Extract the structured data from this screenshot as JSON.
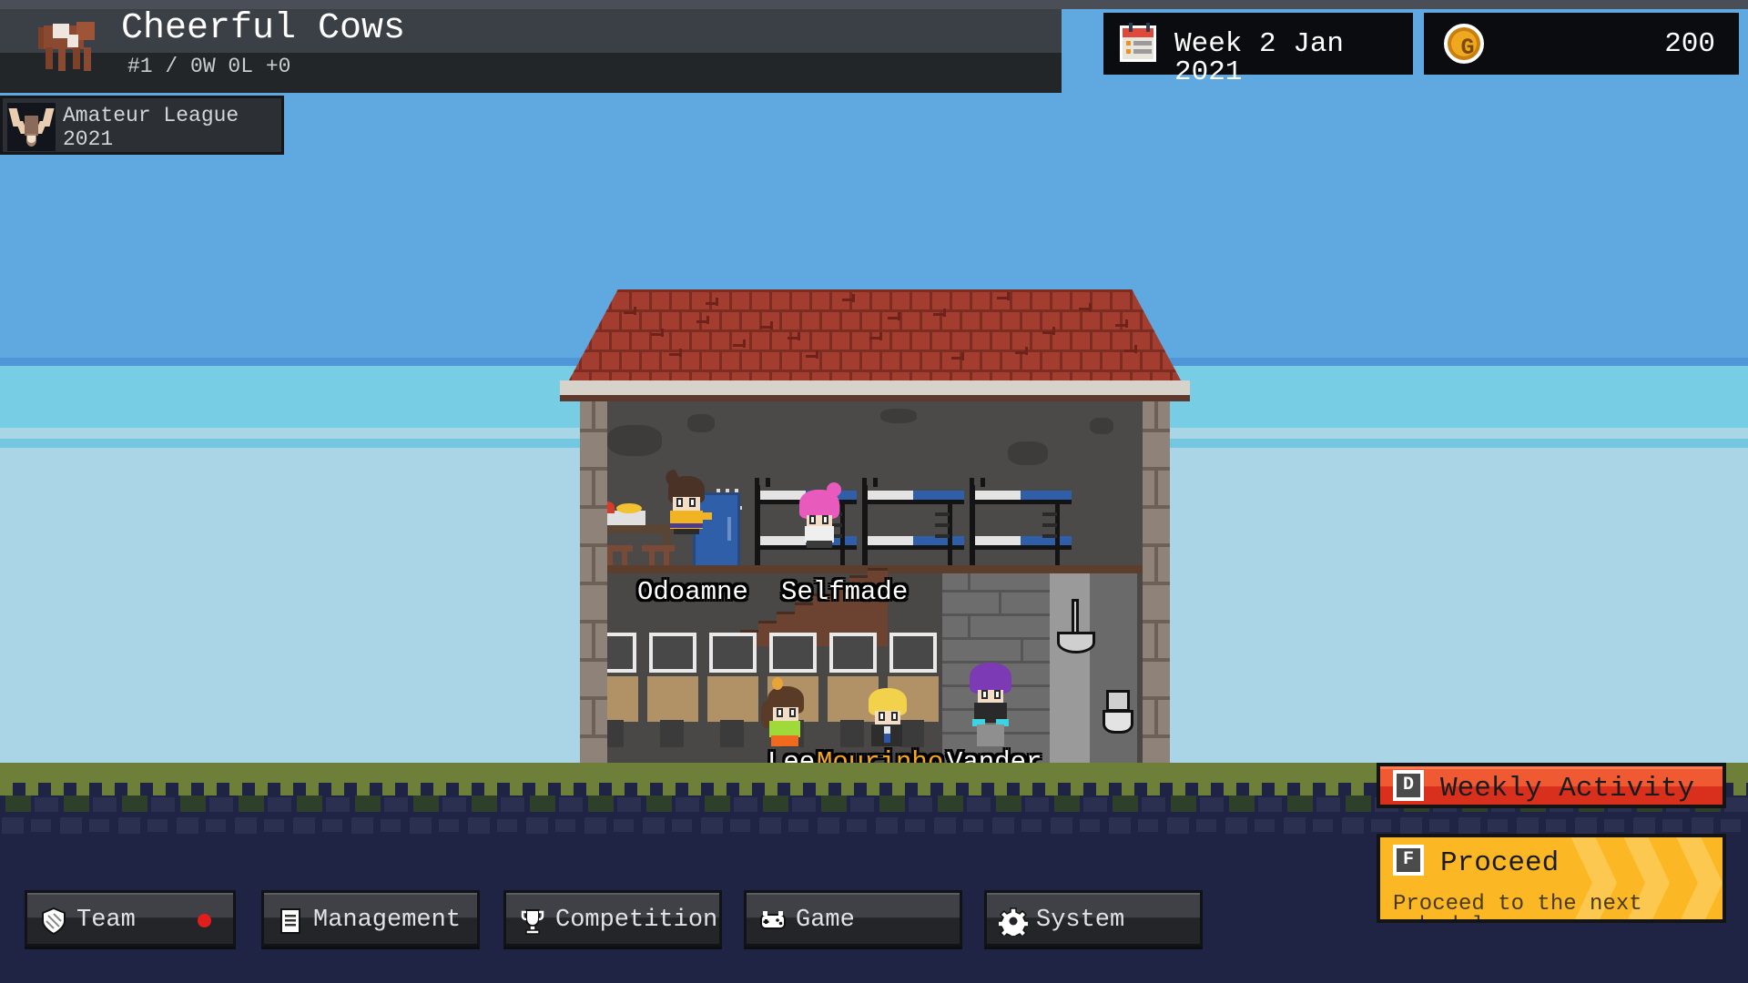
{
  "header": {
    "team_name": "Cheerful Cows",
    "team_record": "#1 / 0W 0L +0",
    "team_logo_icon": "cow-icon",
    "league_icon": "antler-badge-icon",
    "league_name": "Amateur League",
    "league_year": "2021",
    "calendar_icon": "calendar-icon",
    "date_label": "Week 2 Jan 2021",
    "currency_icon": "gold-coin-icon",
    "currency_amount": "200"
  },
  "scene": {
    "characters": [
      {
        "name": "Odoamne",
        "role": "player",
        "color": "#ffffff"
      },
      {
        "name": "Selfmade",
        "role": "player",
        "color": "#ffffff"
      },
      {
        "name": "Lee",
        "role": "player",
        "color": "#ffffff"
      },
      {
        "name": "Mourinho",
        "role": "coach",
        "color": "#f5a623"
      },
      {
        "name": "Vander",
        "role": "player",
        "color": "#ffffff"
      }
    ]
  },
  "actions": {
    "weekly": {
      "key": "D",
      "label": "Weekly Activity",
      "color": "#e8432a"
    },
    "proceed": {
      "key": "F",
      "label": "Proceed",
      "description": "Proceed to the next schedule",
      "color": "#fbb824"
    }
  },
  "nav": {
    "items": [
      {
        "id": "team",
        "label": "Team",
        "icon": "shield-icon",
        "notification": true
      },
      {
        "id": "management",
        "label": "Management",
        "icon": "document-icon",
        "notification": false
      },
      {
        "id": "competition",
        "label": "Competition",
        "icon": "trophy-icon",
        "notification": false
      },
      {
        "id": "game",
        "label": "Game",
        "icon": "gamepad-icon",
        "notification": false
      },
      {
        "id": "system",
        "label": "System",
        "icon": "gear-icon",
        "notification": false
      }
    ]
  },
  "colors": {
    "sky_top": "#5fa8e0",
    "sky_bottom": "#a9d5e6",
    "grass": "#6d7f38",
    "soil": "#1f2444",
    "roof": "#a23d30",
    "accent_red": "#e8432a",
    "accent_yellow": "#fbb824"
  }
}
